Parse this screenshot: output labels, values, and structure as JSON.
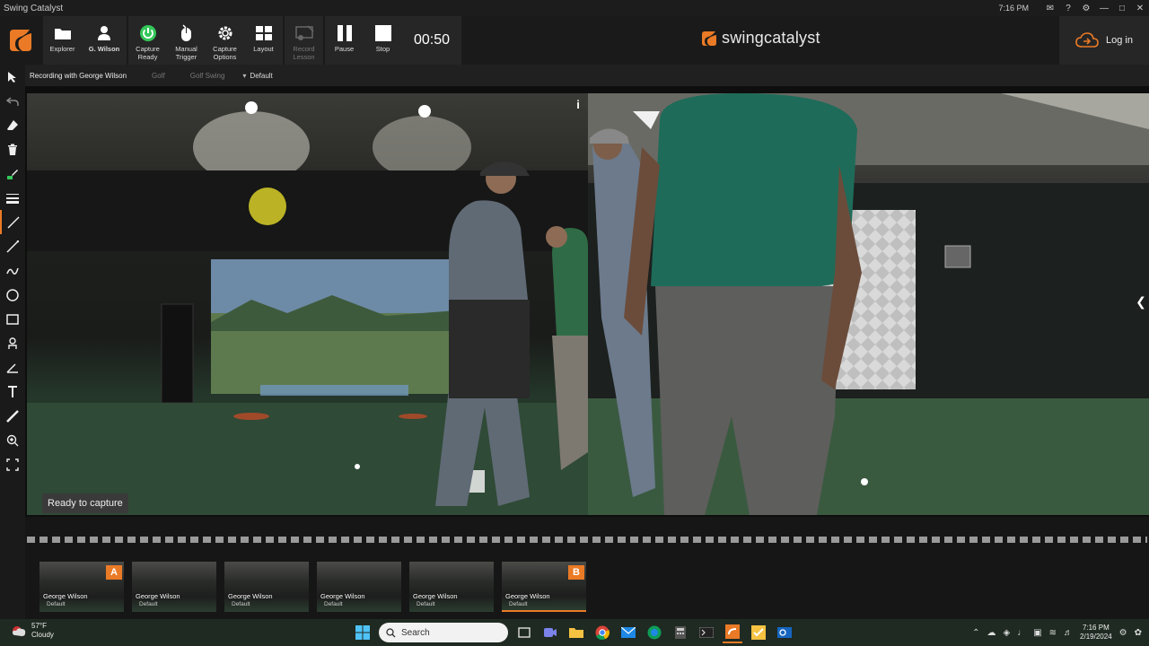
{
  "window": {
    "title": "Swing Catalyst",
    "time": "7:16 PM",
    "controls": [
      "✉",
      "?",
      "⚙",
      "—",
      "□",
      "✕"
    ]
  },
  "toolbar": {
    "buttons": [
      {
        "label": "Explorer",
        "icon": "folder-icon"
      },
      {
        "label": "G. Wilson",
        "icon": "user-icon"
      },
      {
        "label": "Capture\nReady",
        "icon": "power-icon"
      },
      {
        "label": "Manual\nTrigger",
        "icon": "mouse-icon"
      },
      {
        "label": "Capture\nOptions",
        "icon": "gear-icon"
      },
      {
        "label": "Layout",
        "icon": "grid-icon"
      },
      {
        "label": "Record\nLesson",
        "icon": "record-lesson-icon"
      },
      {
        "label": "Pause",
        "icon": "pause-icon"
      },
      {
        "label": "Stop",
        "icon": "stop-icon"
      }
    ],
    "timer": "00:50",
    "brand": "swingcatalyst",
    "login_label": "Log in"
  },
  "breadcrumb": {
    "recording": "Recording with George Wilson",
    "sport": "Golf",
    "activity": "Golf Swing",
    "setup": "Default"
  },
  "video": {
    "status": "Ready to capture",
    "info": "i"
  },
  "thumbnails": [
    {
      "name": "George Wilson",
      "sub": "Default",
      "badge": "A"
    },
    {
      "name": "George Wilson",
      "sub": "Default",
      "badge": ""
    },
    {
      "name": "George Wilson",
      "sub": "Default",
      "badge": ""
    },
    {
      "name": "George Wilson",
      "sub": "Default",
      "badge": ""
    },
    {
      "name": "George Wilson",
      "sub": "Default",
      "badge": ""
    },
    {
      "name": "George Wilson",
      "sub": "Default",
      "badge": "B"
    }
  ],
  "taskbar": {
    "temp": "57°F",
    "condition": "Cloudy",
    "search_placeholder": "Search",
    "time": "7:16 PM",
    "date": "2/19/2024"
  },
  "colors": {
    "accent": "#ea7a26",
    "ready_green": "#34c759",
    "cursor_highlight": "#d8cf28"
  }
}
